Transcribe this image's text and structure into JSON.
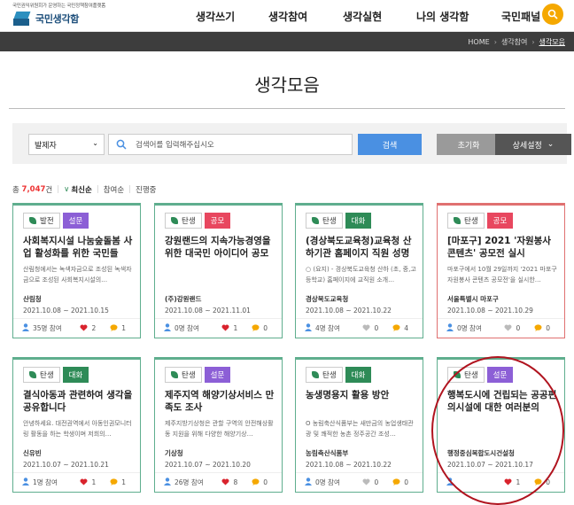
{
  "header": {
    "tagline": "국민권익위원회가 운영하는 국민정책참여플랫폼",
    "logo_text": "국민생각함",
    "nav": [
      "생각쓰기",
      "생각참여",
      "생각실현",
      "나의 생각함",
      "국민패널"
    ],
    "accent": "#f5a800"
  },
  "breadcrumb": {
    "home": "HOME",
    "section": "생각참여",
    "current": "생각모음"
  },
  "page_title": "생각모음",
  "search": {
    "select_value": "발제자",
    "placeholder": "검색어를 입력해주십시오",
    "search_label": "검색",
    "reset_label": "초기화",
    "detail_label": "상세설정"
  },
  "sort": {
    "total_prefix": "총",
    "total_count": "7,047",
    "total_suffix": "건",
    "options": [
      "최신순",
      "참여순",
      "진행중"
    ]
  },
  "cards": [
    {
      "stage": "발전",
      "type": "설문",
      "type_class": "bt-survey",
      "color": "green",
      "title": "사회복지시설 나눔숲돌봄 사업 활성화를 위한 국민들의…",
      "desc": "산림청에서는 녹색자금으로 조성된 녹색자금으로 조성된 사회복지시설의…",
      "org": "산림청",
      "date": "2021.10.08 ~ 2021.10.15",
      "participants": "35명 참여",
      "likes": "2",
      "comments": "1",
      "like_active": true
    },
    {
      "stage": "탄생",
      "type": "공모",
      "type_class": "bt-contest",
      "color": "green",
      "title": "강원랜드의 지속가능경영을 위한 대국민 아이디어 공모전",
      "desc": "",
      "org": "(주)강원랜드",
      "date": "2021.10.08 ~ 2021.11.01",
      "participants": "0명 참여",
      "likes": "1",
      "comments": "0",
      "like_active": true
    },
    {
      "stage": "탄생",
      "type": "대화",
      "type_class": "bt-talk",
      "color": "green",
      "title": "(경상북도교육청)교육청 산하기관 홈페이지 직원 성명 공개",
      "desc": "○ (요지) - 경상북도교육청 산하 (초, 중,고등학교) 홈페이지에 교직원 소개…",
      "org": "경상북도교육청",
      "date": "2021.10.08 ~ 2021.10.22",
      "participants": "4명 참여",
      "likes": "0",
      "comments": "4",
      "like_active": false
    },
    {
      "stage": "탄생",
      "type": "공모",
      "type_class": "bt-contest",
      "color": "red",
      "title": "[마포구] 2021 '자원봉사 콘텐츠' 공모전 실시",
      "desc": "마포구에서 10월 29일까지 '2021 마포구 자원봉사 콘텐츠 공모전'을 실시한…",
      "org": "서울특별시 마포구",
      "date": "2021.10.08 ~ 2021.10.29",
      "participants": "0명 참여",
      "likes": "0",
      "comments": "0",
      "like_active": false
    },
    {
      "stage": "탄생",
      "type": "대화",
      "type_class": "bt-talk",
      "color": "green",
      "title": "결식아동과 관련하여 생각을 공유합니다",
      "desc": "안녕하세요. 대전권역에서 아동인권모니터링 활동을 하는 학생이며 저희의…",
      "org": "신유빈",
      "date": "2021.10.07 ~ 2021.10.21",
      "participants": "1명 참여",
      "likes": "1",
      "comments": "1",
      "like_active": true
    },
    {
      "stage": "탄생",
      "type": "설문",
      "type_class": "bt-survey",
      "color": "green",
      "title": "제주지역 해양기상서비스 만족도 조사",
      "desc": "제주지방기상청은 관할 구역의 안전해상활동 지원을 위해 다양한 해양기상…",
      "org": "기상청",
      "date": "2021.10.07 ~ 2021.10.20",
      "participants": "26명 참여",
      "likes": "8",
      "comments": "0",
      "like_active": true
    },
    {
      "stage": "탄생",
      "type": "대화",
      "type_class": "bt-talk",
      "color": "green",
      "title": "농생명용지 활용 방안",
      "desc": "O 농림축산식품부는 새만금의 농업생태관광 및 쾌적한 농촌 정주공간 조성…",
      "org": "농림축산식품부",
      "date": "2021.10.08 ~ 2021.10.22",
      "participants": "0명 참여",
      "likes": "0",
      "comments": "0",
      "like_active": false
    },
    {
      "stage": "탄생",
      "type": "설문",
      "type_class": "bt-survey",
      "color": "green",
      "title": "행복도시에 건립되는 공공편의시설에 대한 여러분의 의…",
      "desc": "",
      "org": "행정중심복합도시건설청",
      "date": "2021.10.07 ~ 2021.10.17",
      "participants": "",
      "likes": "1",
      "comments": "0",
      "like_active": true
    }
  ]
}
